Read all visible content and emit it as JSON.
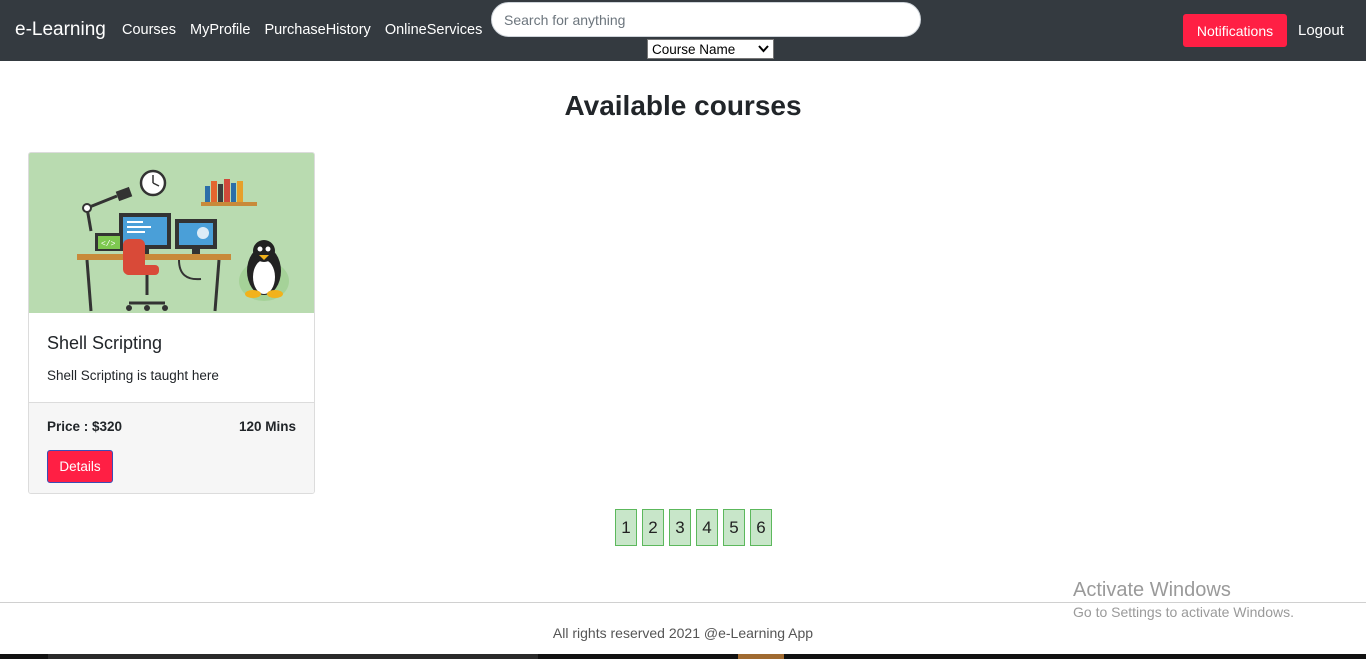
{
  "navbar": {
    "brand": "e-Learning",
    "links": [
      "Courses",
      "MyProfile",
      "PurchaseHistory",
      "OnlineServices"
    ],
    "search_placeholder": "Search for anything",
    "filter_selected": "Course Name",
    "notifications_label": "Notifications",
    "logout_label": "Logout"
  },
  "main": {
    "title": "Available courses",
    "courses": [
      {
        "title": "Shell Scripting",
        "description": "Shell Scripting is taught here",
        "price": "Price : $320",
        "duration": "120 Mins",
        "details_label": "Details"
      }
    ],
    "pages": [
      "1",
      "2",
      "3",
      "4",
      "5",
      "6"
    ]
  },
  "footer": {
    "text": "All rights reserved 2021 @e-Learning App"
  },
  "watermark": {
    "title": "Activate Windows",
    "subtitle": "Go to Settings to activate Windows."
  },
  "colors": {
    "navbar_bg": "#343a40",
    "accent_red": "#ff1f44",
    "page_btn_bg": "#c8e6c9",
    "card_image_bg": "#b9dbb0"
  }
}
